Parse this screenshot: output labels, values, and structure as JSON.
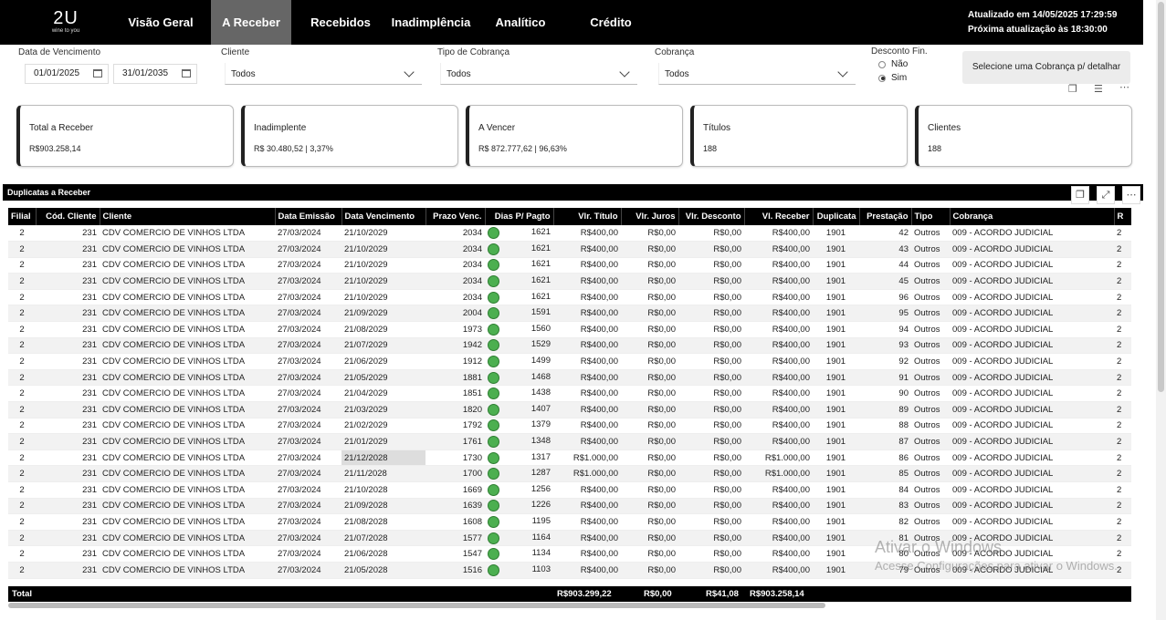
{
  "brand": {
    "name": "2U",
    "tagline": "wine to you"
  },
  "nav": [
    "Visão Geral",
    "A Receber",
    "Recebidos",
    "Inadimplência",
    "Analítico",
    "Crédito"
  ],
  "update": {
    "line1": "Atualizado em 14/05/2025 17:29:59",
    "line2": "Próxima atualização às 18:30:00"
  },
  "filters": {
    "vencimento_label": "Data de Vencimento",
    "date_from": "01/01/2025",
    "date_to": "31/01/2035",
    "cliente_label": "Cliente",
    "cliente_value": "Todos",
    "tipo_label": "Tipo de Cobrança",
    "tipo_value": "Todos",
    "cobranca_label": "Cobrança",
    "cobranca_value": "Todos",
    "desconto_label": "Desconto Fin.",
    "desconto_opt1": "Não",
    "desconto_opt2": "Sim",
    "detail_button": "Selecione uma Cobrança p/ detalhar"
  },
  "cards": [
    {
      "title": "Total a Receber",
      "value": "R$903.258,14"
    },
    {
      "title": "Inadimplente",
      "value": "R$ 30.480,52 | 3,37%"
    },
    {
      "title": "A Vencer",
      "value": "R$ 872.777,62 | 96,63%"
    },
    {
      "title": "Títulos",
      "value": "188"
    },
    {
      "title": "Clientes",
      "value": "188"
    }
  ],
  "table_title": "Duplicatas a Receber",
  "columns": [
    "Filial",
    "Cód. Cliente",
    "Cliente",
    "Data Emissão",
    "Data Vencimento",
    "Prazo Venc.",
    "Dias P/ Pagto",
    "Vlr. Título",
    "Vlr. Juros",
    "Vlr. Desconto",
    "Vl. Receber",
    "Duplicata",
    "Prestação",
    "Tipo",
    "Cobrança",
    "R"
  ],
  "rows": [
    [
      "2",
      "231",
      "CDV COMERCIO DE VINHOS LTDA",
      "27/03/2024",
      "21/10/2029",
      "2034",
      "1621",
      "R$400,00",
      "R$0,00",
      "R$0,00",
      "R$400,00",
      "1901",
      "42",
      "Outros",
      "009 - ACORDO JUDICIAL",
      "2"
    ],
    [
      "2",
      "231",
      "CDV COMERCIO DE VINHOS LTDA",
      "27/03/2024",
      "21/10/2029",
      "2034",
      "1621",
      "R$400,00",
      "R$0,00",
      "R$0,00",
      "R$400,00",
      "1901",
      "43",
      "Outros",
      "009 - ACORDO JUDICIAL",
      "2"
    ],
    [
      "2",
      "231",
      "CDV COMERCIO DE VINHOS LTDA",
      "27/03/2024",
      "21/10/2029",
      "2034",
      "1621",
      "R$400,00",
      "R$0,00",
      "R$0,00",
      "R$400,00",
      "1901",
      "44",
      "Outros",
      "009 - ACORDO JUDICIAL",
      "2"
    ],
    [
      "2",
      "231",
      "CDV COMERCIO DE VINHOS LTDA",
      "27/03/2024",
      "21/10/2029",
      "2034",
      "1621",
      "R$400,00",
      "R$0,00",
      "R$0,00",
      "R$400,00",
      "1901",
      "45",
      "Outros",
      "009 - ACORDO JUDICIAL",
      "2"
    ],
    [
      "2",
      "231",
      "CDV COMERCIO DE VINHOS LTDA",
      "27/03/2024",
      "21/10/2029",
      "2034",
      "1621",
      "R$400,00",
      "R$0,00",
      "R$0,00",
      "R$400,00",
      "1901",
      "96",
      "Outros",
      "009 - ACORDO JUDICIAL",
      "2"
    ],
    [
      "2",
      "231",
      "CDV COMERCIO DE VINHOS LTDA",
      "27/03/2024",
      "21/09/2029",
      "2004",
      "1591",
      "R$400,00",
      "R$0,00",
      "R$0,00",
      "R$400,00",
      "1901",
      "95",
      "Outros",
      "009 - ACORDO JUDICIAL",
      "2"
    ],
    [
      "2",
      "231",
      "CDV COMERCIO DE VINHOS LTDA",
      "27/03/2024",
      "21/08/2029",
      "1973",
      "1560",
      "R$400,00",
      "R$0,00",
      "R$0,00",
      "R$400,00",
      "1901",
      "94",
      "Outros",
      "009 - ACORDO JUDICIAL",
      "2"
    ],
    [
      "2",
      "231",
      "CDV COMERCIO DE VINHOS LTDA",
      "27/03/2024",
      "21/07/2029",
      "1942",
      "1529",
      "R$400,00",
      "R$0,00",
      "R$0,00",
      "R$400,00",
      "1901",
      "93",
      "Outros",
      "009 - ACORDO JUDICIAL",
      "2"
    ],
    [
      "2",
      "231",
      "CDV COMERCIO DE VINHOS LTDA",
      "27/03/2024",
      "21/06/2029",
      "1912",
      "1499",
      "R$400,00",
      "R$0,00",
      "R$0,00",
      "R$400,00",
      "1901",
      "92",
      "Outros",
      "009 - ACORDO JUDICIAL",
      "2"
    ],
    [
      "2",
      "231",
      "CDV COMERCIO DE VINHOS LTDA",
      "27/03/2024",
      "21/05/2029",
      "1881",
      "1468",
      "R$400,00",
      "R$0,00",
      "R$0,00",
      "R$400,00",
      "1901",
      "91",
      "Outros",
      "009 - ACORDO JUDICIAL",
      "2"
    ],
    [
      "2",
      "231",
      "CDV COMERCIO DE VINHOS LTDA",
      "27/03/2024",
      "21/04/2029",
      "1851",
      "1438",
      "R$400,00",
      "R$0,00",
      "R$0,00",
      "R$400,00",
      "1901",
      "90",
      "Outros",
      "009 - ACORDO JUDICIAL",
      "2"
    ],
    [
      "2",
      "231",
      "CDV COMERCIO DE VINHOS LTDA",
      "27/03/2024",
      "21/03/2029",
      "1820",
      "1407",
      "R$400,00",
      "R$0,00",
      "R$0,00",
      "R$400,00",
      "1901",
      "89",
      "Outros",
      "009 - ACORDO JUDICIAL",
      "2"
    ],
    [
      "2",
      "231",
      "CDV COMERCIO DE VINHOS LTDA",
      "27/03/2024",
      "21/02/2029",
      "1792",
      "1379",
      "R$400,00",
      "R$0,00",
      "R$0,00",
      "R$400,00",
      "1901",
      "88",
      "Outros",
      "009 - ACORDO JUDICIAL",
      "2"
    ],
    [
      "2",
      "231",
      "CDV COMERCIO DE VINHOS LTDA",
      "27/03/2024",
      "21/01/2029",
      "1761",
      "1348",
      "R$400,00",
      "R$0,00",
      "R$0,00",
      "R$400,00",
      "1901",
      "87",
      "Outros",
      "009 - ACORDO JUDICIAL",
      "2"
    ],
    [
      "2",
      "231",
      "CDV COMERCIO DE VINHOS LTDA",
      "27/03/2024",
      "21/12/2028",
      "1730",
      "1317",
      "R$1.000,00",
      "R$0,00",
      "R$0,00",
      "R$1.000,00",
      "1901",
      "86",
      "Outros",
      "009 - ACORDO JUDICIAL",
      "2"
    ],
    [
      "2",
      "231",
      "CDV COMERCIO DE VINHOS LTDA",
      "27/03/2024",
      "21/11/2028",
      "1700",
      "1287",
      "R$1.000,00",
      "R$0,00",
      "R$0,00",
      "R$1.000,00",
      "1901",
      "85",
      "Outros",
      "009 - ACORDO JUDICIAL",
      "2"
    ],
    [
      "2",
      "231",
      "CDV COMERCIO DE VINHOS LTDA",
      "27/03/2024",
      "21/10/2028",
      "1669",
      "1256",
      "R$400,00",
      "R$0,00",
      "R$0,00",
      "R$400,00",
      "1901",
      "84",
      "Outros",
      "009 - ACORDO JUDICIAL",
      "2"
    ],
    [
      "2",
      "231",
      "CDV COMERCIO DE VINHOS LTDA",
      "27/03/2024",
      "21/09/2028",
      "1639",
      "1226",
      "R$400,00",
      "R$0,00",
      "R$0,00",
      "R$400,00",
      "1901",
      "83",
      "Outros",
      "009 - ACORDO JUDICIAL",
      "2"
    ],
    [
      "2",
      "231",
      "CDV COMERCIO DE VINHOS LTDA",
      "27/03/2024",
      "21/08/2028",
      "1608",
      "1195",
      "R$400,00",
      "R$0,00",
      "R$0,00",
      "R$400,00",
      "1901",
      "82",
      "Outros",
      "009 - ACORDO JUDICIAL",
      "2"
    ],
    [
      "2",
      "231",
      "CDV COMERCIO DE VINHOS LTDA",
      "27/03/2024",
      "21/07/2028",
      "1577",
      "1164",
      "R$400,00",
      "R$0,00",
      "R$0,00",
      "R$400,00",
      "1901",
      "81",
      "Outros",
      "009 - ACORDO JUDICIAL",
      "2"
    ],
    [
      "2",
      "231",
      "CDV COMERCIO DE VINHOS LTDA",
      "27/03/2024",
      "21/06/2028",
      "1547",
      "1134",
      "R$400,00",
      "R$0,00",
      "R$0,00",
      "R$400,00",
      "1901",
      "80",
      "Outros",
      "009 - ACORDO JUDICIAL",
      "2"
    ],
    [
      "2",
      "231",
      "CDV COMERCIO DE VINHOS LTDA",
      "27/03/2024",
      "21/05/2028",
      "1516",
      "1103",
      "R$400,00",
      "R$0,00",
      "R$0,00",
      "R$400,00",
      "1901",
      "79",
      "Outros",
      "009 - ACORDO JUDICIAL",
      "2"
    ]
  ],
  "total": {
    "label": "Total",
    "titulo": "R$903.299,22",
    "juros": "R$0,00",
    "desconto": "R$41,08",
    "receber": "R$903.258,14"
  },
  "watermark": {
    "line1": "Ativar o Windows",
    "line2": "Acesse Configurações para ativar o Windows."
  },
  "colors": {
    "status_ok": "#4caf50",
    "header_bg": "#000000",
    "active_tab": "#666666"
  }
}
